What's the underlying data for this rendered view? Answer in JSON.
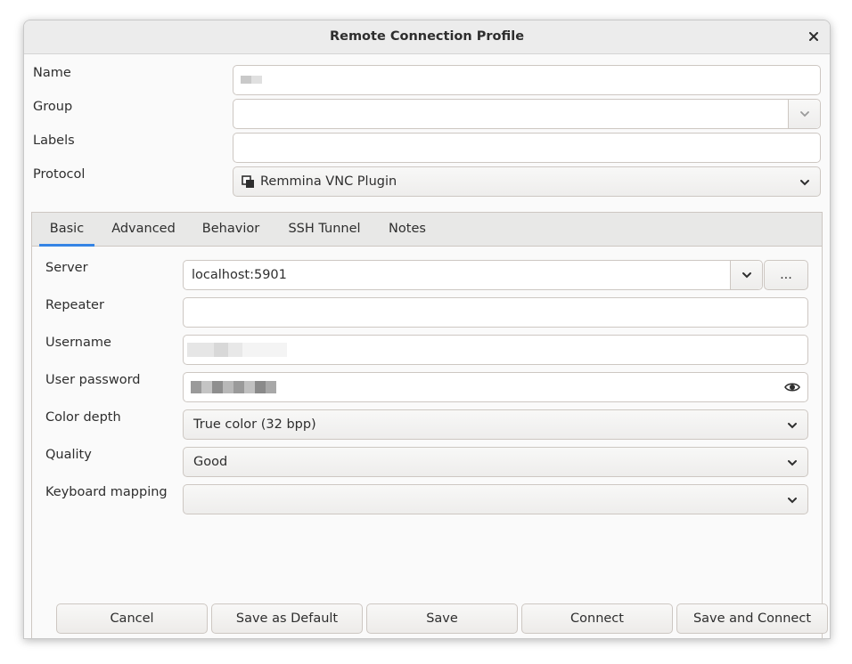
{
  "window": {
    "title": "Remote Connection Profile"
  },
  "profile": {
    "name_label": "Name",
    "group_label": "Group",
    "labels_label": "Labels",
    "protocol_label": "Protocol",
    "protocol_value": "Remmina VNC Plugin"
  },
  "tabs": [
    {
      "label": "Basic",
      "active": true
    },
    {
      "label": "Advanced",
      "active": false
    },
    {
      "label": "Behavior",
      "active": false
    },
    {
      "label": "SSH Tunnel",
      "active": false
    },
    {
      "label": "Notes",
      "active": false
    }
  ],
  "basic": {
    "server_label": "Server",
    "server_value": "localhost:5901",
    "browse_label": "...",
    "repeater_label": "Repeater",
    "username_label": "Username",
    "password_label": "User password",
    "color_depth_label": "Color depth",
    "color_depth_value": "True color (32 bpp)",
    "quality_label": "Quality",
    "quality_value": "Good",
    "keyboard_label": "Keyboard mapping",
    "keyboard_value": ""
  },
  "buttons": {
    "cancel": "Cancel",
    "save_default": "Save as Default",
    "save": "Save",
    "connect": "Connect",
    "save_connect": "Save and Connect"
  },
  "icons": {
    "close": "close-icon",
    "chevron": "chevron-down-icon",
    "protocol": "vnc-plugin-icon",
    "reveal": "eye-icon"
  },
  "colors": {
    "accent": "#3584e4"
  }
}
